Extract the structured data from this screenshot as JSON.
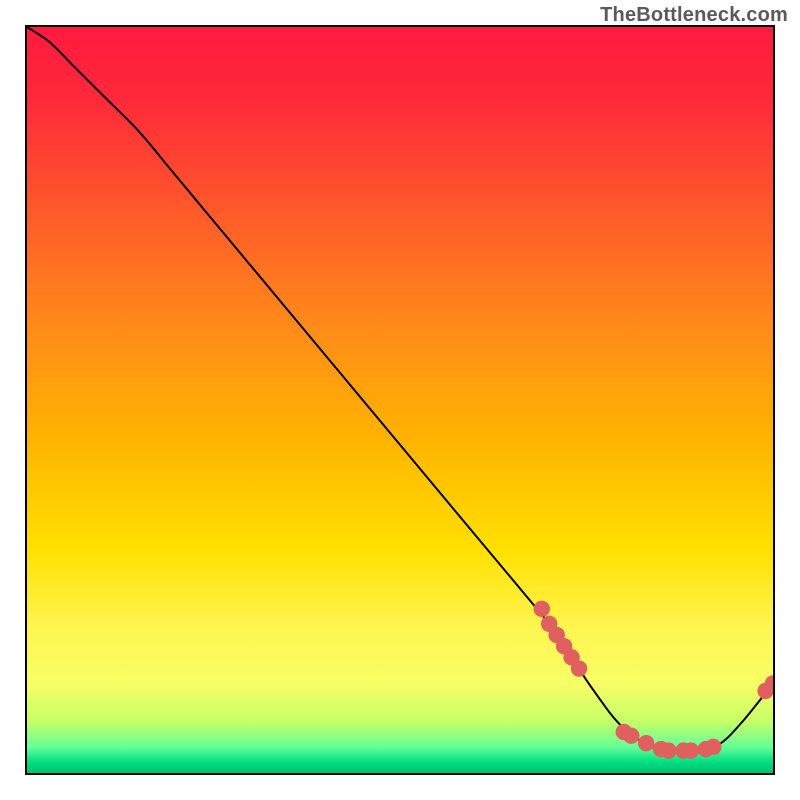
{
  "watermark": "TheBottleneck.com",
  "gradient": {
    "stops": [
      {
        "offset": 0.0,
        "color": "#ff1a40"
      },
      {
        "offset": 0.1,
        "color": "#ff2a3a"
      },
      {
        "offset": 0.25,
        "color": "#ff5a2a"
      },
      {
        "offset": 0.4,
        "color": "#ff8a1a"
      },
      {
        "offset": 0.55,
        "color": "#ffb300"
      },
      {
        "offset": 0.7,
        "color": "#ffe000"
      },
      {
        "offset": 0.8,
        "color": "#fff44d"
      },
      {
        "offset": 0.88,
        "color": "#f7ff66"
      },
      {
        "offset": 0.93,
        "color": "#c8ff66"
      },
      {
        "offset": 0.965,
        "color": "#66ff99"
      },
      {
        "offset": 0.985,
        "color": "#00e080"
      },
      {
        "offset": 1.0,
        "color": "#00c070"
      }
    ]
  },
  "chart_data": {
    "type": "line",
    "title": "",
    "xlabel": "",
    "ylabel": "",
    "xlim": [
      0,
      100
    ],
    "ylim": [
      0,
      100
    ],
    "series": [
      {
        "name": "curve",
        "x": [
          0,
          3,
          6,
          10,
          15,
          20,
          30,
          40,
          50,
          60,
          70,
          72,
          76,
          80,
          85,
          90,
          93,
          96,
          100
        ],
        "y": [
          100,
          98,
          95,
          91,
          86,
          80,
          68,
          56,
          44,
          32,
          20,
          17,
          11,
          6,
          3,
          3,
          4,
          7,
          12
        ]
      }
    ],
    "markers": {
      "name": "highlight-points",
      "color": "#e06060",
      "radius": 6,
      "points": [
        {
          "x": 69,
          "y": 22
        },
        {
          "x": 70,
          "y": 20
        },
        {
          "x": 71,
          "y": 18.5
        },
        {
          "x": 72,
          "y": 17
        },
        {
          "x": 73,
          "y": 15.5
        },
        {
          "x": 74,
          "y": 14
        },
        {
          "x": 80,
          "y": 5.5
        },
        {
          "x": 81,
          "y": 5
        },
        {
          "x": 83,
          "y": 4
        },
        {
          "x": 85,
          "y": 3.2
        },
        {
          "x": 86,
          "y": 3
        },
        {
          "x": 88,
          "y": 3
        },
        {
          "x": 89,
          "y": 3
        },
        {
          "x": 91,
          "y": 3.2
        },
        {
          "x": 92,
          "y": 3.5
        },
        {
          "x": 99,
          "y": 11
        },
        {
          "x": 100,
          "y": 12
        }
      ]
    }
  }
}
